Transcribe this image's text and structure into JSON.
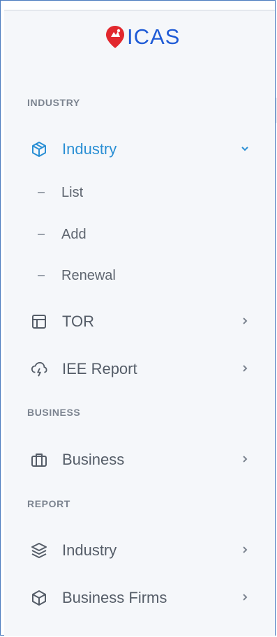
{
  "brand": {
    "name": "ICAS",
    "accent": "#1f5bd6",
    "pin_color": "#e2282e"
  },
  "sections": {
    "industry": "INDUSTRY",
    "business": "BUSINESS",
    "report": "REPORT"
  },
  "menu": {
    "industry": {
      "label": "Industry",
      "icon": "cube-icon",
      "expanded": true,
      "active_color": "#2a8fd4"
    },
    "industry_sub": [
      {
        "label": "List"
      },
      {
        "label": "Add"
      },
      {
        "label": "Renewal"
      }
    ],
    "tor": {
      "label": "TOR",
      "icon": "layout-icon"
    },
    "iee": {
      "label": "IEE Report",
      "icon": "cloud-lightning-icon"
    },
    "business": {
      "label": "Business",
      "icon": "briefcase-icon"
    },
    "report_industry": {
      "label": "Industry",
      "icon": "layers-icon"
    },
    "report_firms": {
      "label": "Business Firms",
      "icon": "box-icon"
    }
  }
}
